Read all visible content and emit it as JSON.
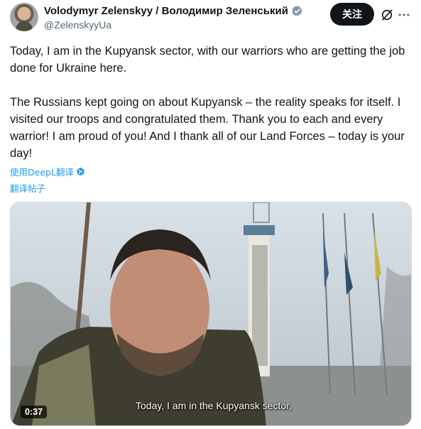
{
  "author": {
    "display_name": "Volodymyr Zelenskyy / Володимир Зеленський",
    "handle": "@ZelenskyyUa",
    "verified_icon": "verified-badge-icon"
  },
  "actions": {
    "follow_label": "关注",
    "grok_icon": "grok-icon",
    "more_icon": "more-icon"
  },
  "tweet": {
    "paragraph_1": "Today, I am in the Kupyansk sector, with our warriors who are getting the job done for Ukraine here.",
    "paragraph_2": "The Russians kept going on about Kupyansk – the reality speaks for itself. I visited our troops and congratulated them. Thank you to each and every warrior! I am proud of you! And I thank all of our Land Forces – today is your day!"
  },
  "translation": {
    "deepl_label": "使用DeepL翻译",
    "translate_post_label": "翻译帖子"
  },
  "video": {
    "subtitle": "Today, I am in the Kupyansk sector,",
    "duration": "0:37"
  },
  "colors": {
    "link": "#1d9bf0",
    "verified": "#829aab",
    "text": "#0f1419",
    "secondary": "#536471"
  }
}
